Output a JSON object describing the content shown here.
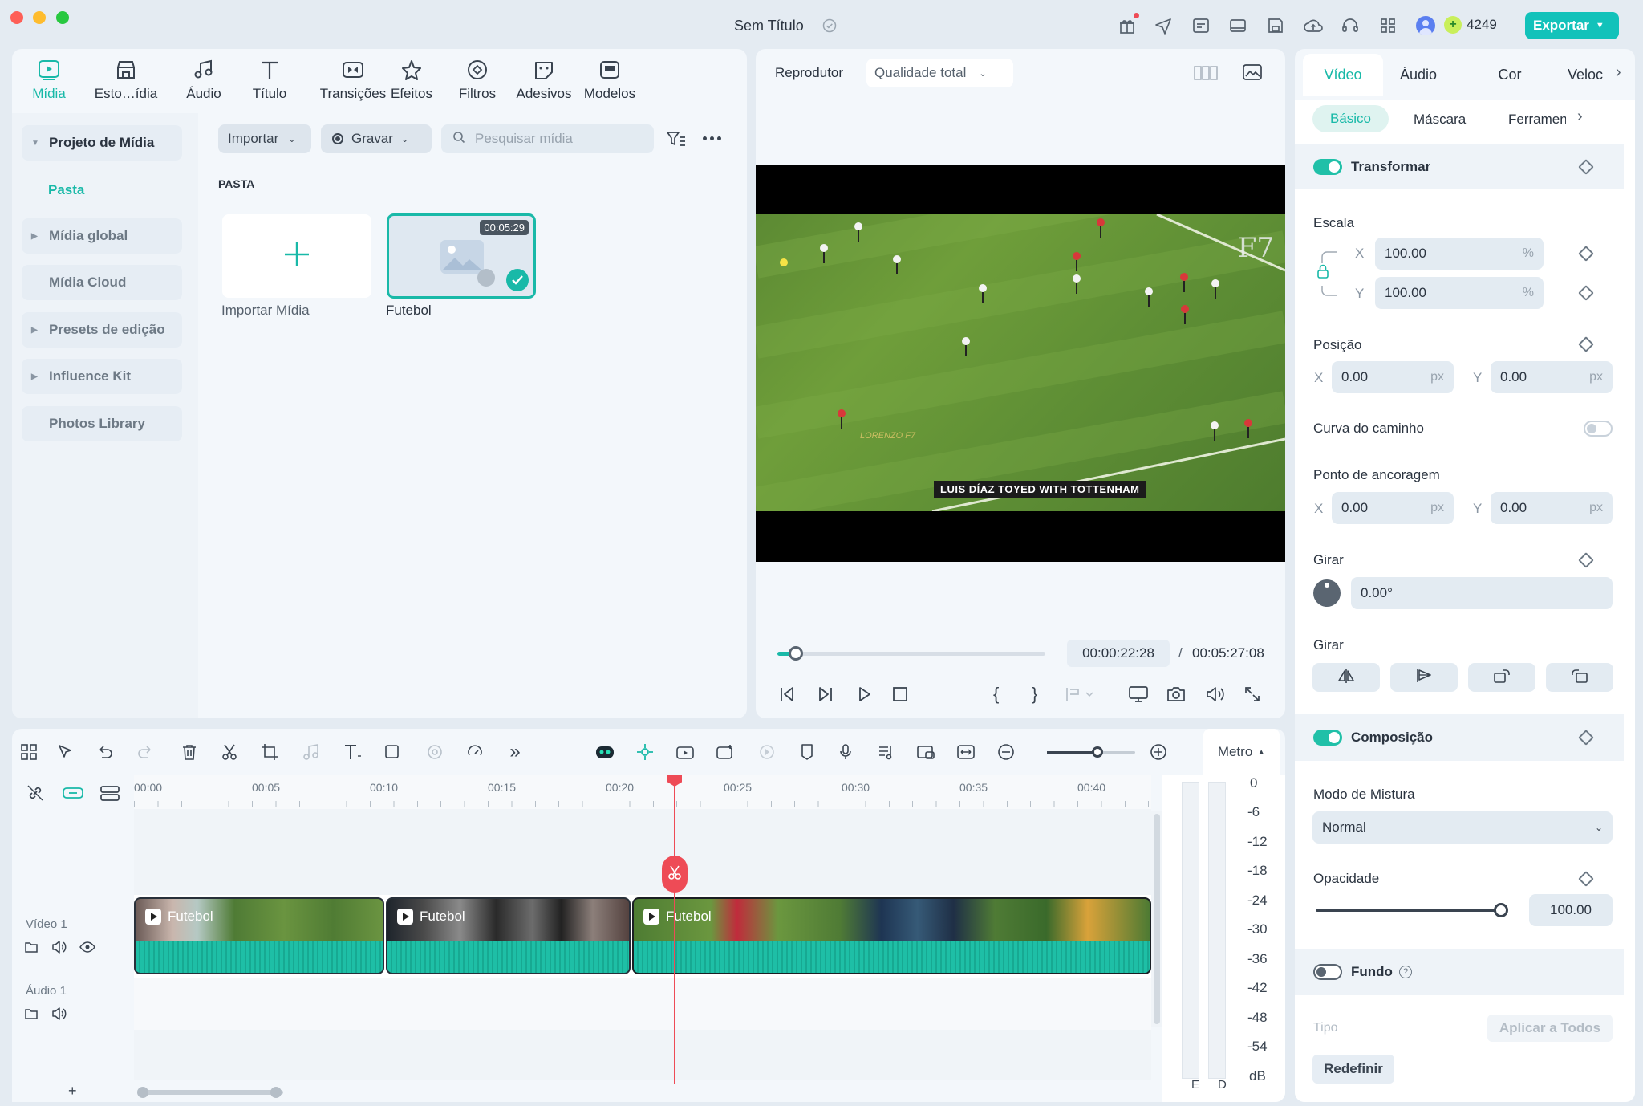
{
  "window": {
    "title": "Sem Título",
    "credits": "4249",
    "export_label": "Exportar"
  },
  "toolbar": {
    "tabs": [
      {
        "label": "Mídia",
        "icon": "media-icon",
        "active": true
      },
      {
        "label": "Esto…ídia",
        "icon": "store-icon"
      },
      {
        "label": "Áudio",
        "icon": "music-note-icon"
      },
      {
        "label": "Título",
        "icon": "text-icon"
      },
      {
        "label": "Transições",
        "icon": "transition-icon"
      },
      {
        "label": "Efeitos",
        "icon": "effects-icon"
      },
      {
        "label": "Filtros",
        "icon": "filter-icon"
      },
      {
        "label": "Adesivos",
        "icon": "sticker-icon"
      },
      {
        "label": "Modelos",
        "icon": "templates-icon"
      }
    ]
  },
  "sidebar": {
    "items": [
      {
        "label": "Projeto de Mídia",
        "expandable": true
      },
      {
        "label": "Pasta",
        "active": true
      },
      {
        "label": "Mídia global",
        "expandable": true
      },
      {
        "label": "Mídia Cloud"
      },
      {
        "label": "Presets de edição",
        "expandable": true
      },
      {
        "label": "Influence Kit",
        "expandable": true
      },
      {
        "label": "Photos Library"
      }
    ]
  },
  "media": {
    "import_label": "Importar",
    "record_label": "Gravar",
    "search_placeholder": "Pesquisar mídia",
    "section": "PASTA",
    "import_tile_label": "Importar Mídia",
    "clip_name": "Futebol",
    "clip_duration": "00:05:29"
  },
  "player": {
    "label": "Reprodutor",
    "quality": "Qualidade total",
    "current_time": "00:00:22:28",
    "separator": "/",
    "total_time": "00:05:27:08",
    "overlay_banner": "LUIS DÍAZ TOYED WITH TOTTENHAM",
    "overlay_watermark": "F7",
    "overlay_credit": "LORENZO F7",
    "progress_fraction": 0.07
  },
  "inspector": {
    "tabs": [
      "Vídeo",
      "Áudio",
      "Cor",
      "Veloc"
    ],
    "subtabs": [
      "Básico",
      "Máscara",
      "Ferramen"
    ],
    "transform": {
      "label": "Transformar",
      "scale_label": "Escala",
      "scale_x": "100.00",
      "scale_y": "100.00",
      "percent": "%",
      "position_label": "Posição",
      "pos_x": "0.00",
      "pos_y": "0.00",
      "px": "px",
      "path_curve_label": "Curva do caminho",
      "anchor_label": "Ponto de ancoragem",
      "anchor_x": "0.00",
      "anchor_y": "0.00",
      "rotate_label": "Girar",
      "rotate_value": "0.00°",
      "flip_label": "Girar",
      "x": "X",
      "y": "Y"
    },
    "composition": {
      "label": "Composição",
      "blend_label": "Modo de Mistura",
      "blend_value": "Normal",
      "opacity_label": "Opacidade",
      "opacity_value": "100.00"
    },
    "background": {
      "label": "Fundo",
      "type_label": "Tipo",
      "apply_all": "Aplicar a Todos"
    },
    "reset_label": "Redefinir"
  },
  "timeline": {
    "meter_label": "Metro",
    "ruler": [
      "00:00",
      "00:05",
      "00:10",
      "00:15",
      "00:20",
      "00:25",
      "00:30",
      "00:35",
      "00:40"
    ],
    "meter_scale": [
      "0",
      "-6",
      "-12",
      "-18",
      "-24",
      "-30",
      "-36",
      "-42",
      "-48",
      "-54",
      "dB"
    ],
    "meter_channels": [
      "E",
      "D"
    ],
    "tracks": {
      "video": "Vídeo 1",
      "audio": "Áudio 1"
    },
    "clips": [
      {
        "label": "Futebol"
      },
      {
        "label": "Futebol"
      },
      {
        "label": "Futebol"
      }
    ],
    "add_track": "+"
  },
  "colors": {
    "accent": "#19b9a8",
    "playhead": "#ee4b56",
    "export": "#12c2ba"
  }
}
